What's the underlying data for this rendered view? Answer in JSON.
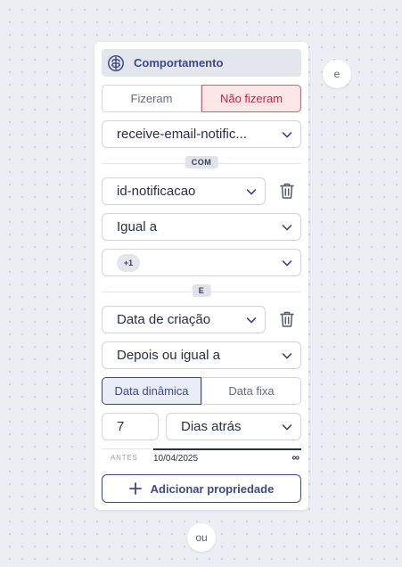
{
  "header": {
    "title": "Comportamento",
    "icon": "brain-icon"
  },
  "behavior_toggle": {
    "options": [
      "Fizeram",
      "Não fizeram"
    ],
    "selected": "Não fizeram"
  },
  "event_select": {
    "value": "receive-email-notific..."
  },
  "connector_com": "COM",
  "property_select": {
    "value": "id-notificacao"
  },
  "operator_select": {
    "value": "Igual a"
  },
  "values_select": {
    "chip": "+1"
  },
  "connector_e": "E",
  "date_property_select": {
    "value": "Data de criação"
  },
  "date_operator_select": {
    "value": "Depois ou igual a"
  },
  "date_mode_toggle": {
    "options": [
      "Data dinâmica",
      "Data fixa"
    ],
    "selected": "Data dinâmica"
  },
  "amount_input": {
    "value": "7"
  },
  "unit_select": {
    "value": "Dias atrás"
  },
  "date_range": {
    "before_label": "ANTES",
    "start_date": "10/04/2025",
    "end_symbol": "∞"
  },
  "add_property_button": {
    "label": "Adicionar propriedade"
  },
  "and_bubble": "e",
  "or_bubble": "ou",
  "colors": {
    "primary": "#3d4a86",
    "danger": "#c2293d",
    "danger_bg": "#fde6e8",
    "canvas": "#eceef4"
  }
}
